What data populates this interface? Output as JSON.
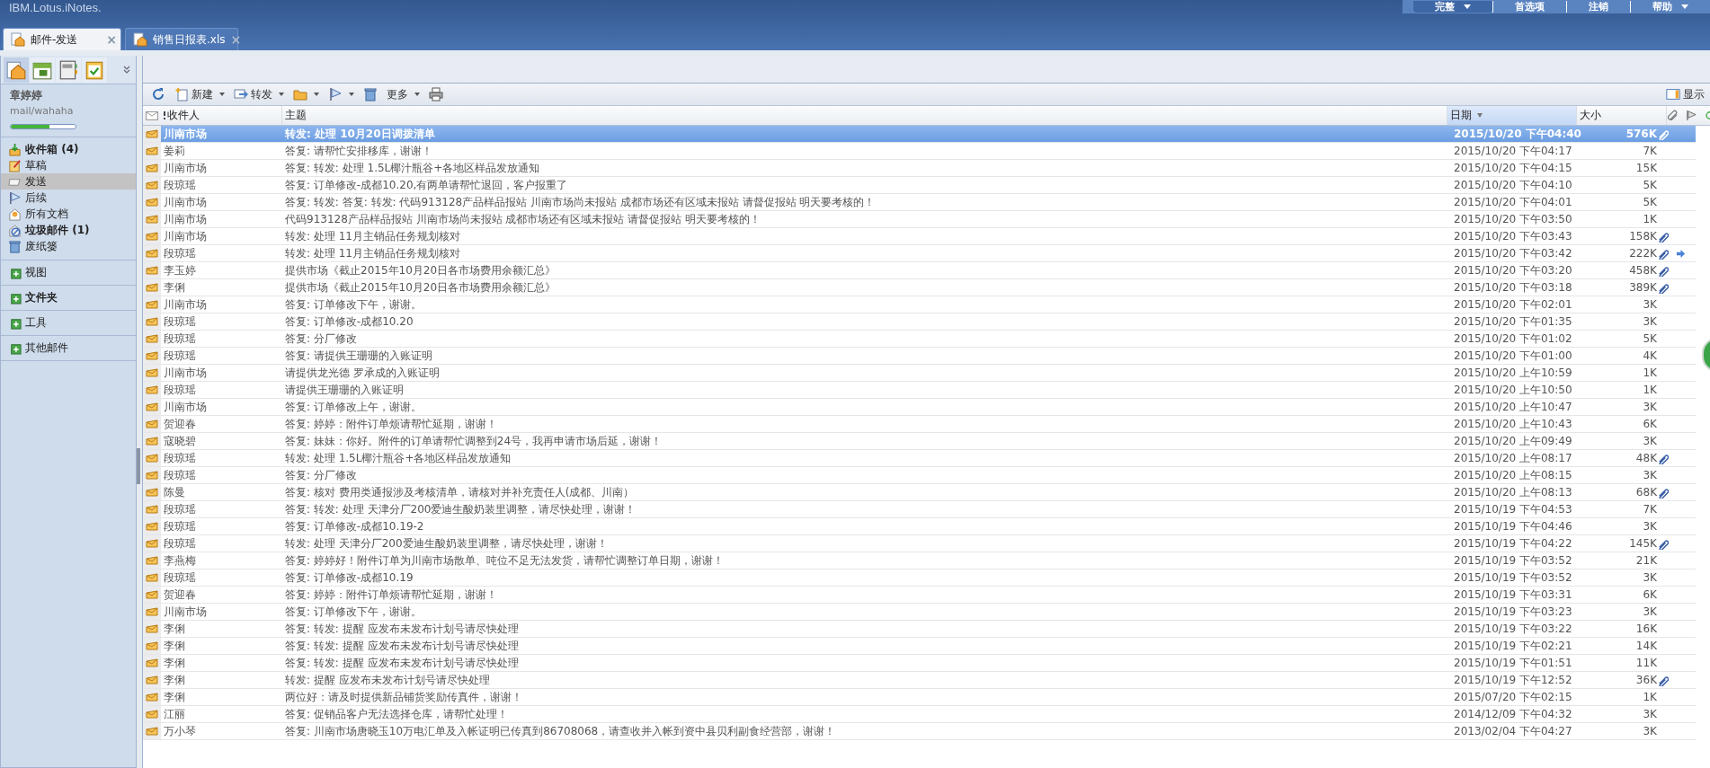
{
  "app": {
    "title": "IBM.Lotus.iNotes."
  },
  "top_menu": [
    {
      "label": "完整",
      "kind": "dropdown"
    },
    {
      "label": "首选项",
      "kind": "link"
    },
    {
      "label": "注销",
      "kind": "link"
    },
    {
      "label": "帮助",
      "kind": "dropdown"
    }
  ],
  "tabs": [
    {
      "label": "邮件-发送",
      "selected": true,
      "close": "×"
    },
    {
      "label": "销售日报表.xls",
      "selected": false,
      "close": "×"
    }
  ],
  "sidebar": {
    "user": "章婷婷",
    "mail_file": "mail/wahaha",
    "quota": {
      "level": 0.6
    },
    "folders": [
      {
        "label": "收件箱 (4)",
        "unread": true,
        "selected": false
      },
      {
        "label": "草稿",
        "unread": false,
        "selected": false
      },
      {
        "label": "发送",
        "unread": false,
        "selected": true
      },
      {
        "label": "后续",
        "unread": false,
        "selected": false
      },
      {
        "label": "所有文档",
        "unread": false,
        "selected": false
      },
      {
        "label": "垃圾邮件 (1)",
        "unread": true,
        "selected": false
      },
      {
        "label": "废纸篓",
        "unread": false,
        "selected": false
      }
    ],
    "sections": [
      {
        "label": "视图",
        "bold": false
      },
      {
        "label": "文件夹",
        "bold": true
      },
      {
        "label": "工具",
        "bold": false
      },
      {
        "label": "其他邮件",
        "bold": false
      }
    ]
  },
  "toolbar": [
    {
      "kind": "refresh",
      "menu": false
    },
    {
      "kind": "new",
      "label": "新建",
      "menu": true
    },
    {
      "kind": "forward",
      "label": "转发",
      "menu": true
    },
    {
      "kind": "folder",
      "menu": true
    },
    {
      "kind": "flag",
      "menu": true
    },
    {
      "kind": "delete",
      "menu": false
    },
    {
      "kind": "more",
      "label": "更多",
      "menu": true
    },
    {
      "kind": "print",
      "menu": false
    }
  ],
  "view_toggle": {
    "label": "显示"
  },
  "table": {
    "columns": [
      {
        "label": "收件人",
        "sorted": false
      },
      {
        "label": "主题",
        "sorted": false
      },
      {
        "label": "日期",
        "sorted": true
      },
      {
        "label": "大小",
        "sorted": false
      }
    ],
    "rows": [
      {
        "to": "川南市场",
        "subject": "转发: 处理 10月20日调拨清单",
        "date": "2015/10/20 下午04:40",
        "size": "576K",
        "attachment": true,
        "forwarded": false,
        "selected": true
      },
      {
        "to": "姜莉",
        "subject": "答复: 请帮忙安排移库，谢谢！",
        "date": "2015/10/20 下午04:17",
        "size": "7K",
        "attachment": false,
        "forwarded": false,
        "selected": false
      },
      {
        "to": "川南市场",
        "subject": "答复: 转发: 处理 1.5L椰汁瓶谷+各地区样品发放通知",
        "date": "2015/10/20 下午04:15",
        "size": "15K",
        "attachment": false,
        "forwarded": false,
        "selected": false
      },
      {
        "to": "段琼瑶",
        "subject": "答复: 订单修改-成都10.20,有两单请帮忙退回，客户报重了",
        "date": "2015/10/20 下午04:10",
        "size": "5K",
        "attachment": false,
        "forwarded": false,
        "selected": false
      },
      {
        "to": "川南市场",
        "subject": "答复: 转发: 答复: 转发: 代码913128产品样品报站 川南市场尚未报站 成都市场还有区域未报站 请督促报站 明天要考核的！",
        "date": "2015/10/20 下午04:01",
        "size": "5K",
        "attachment": false,
        "forwarded": false,
        "selected": false
      },
      {
        "to": "川南市场",
        "subject": "代码913128产品样品报站 川南市场尚未报站 成都市场还有区域未报站 请督促报站 明天要考核的！",
        "date": "2015/10/20 下午03:50",
        "size": "1K",
        "attachment": false,
        "forwarded": false,
        "selected": false
      },
      {
        "to": "川南市场",
        "subject": "转发: 处理 11月主销品任务规划核对",
        "date": "2015/10/20 下午03:43",
        "size": "158K",
        "attachment": true,
        "forwarded": false,
        "selected": false
      },
      {
        "to": "段琼瑶",
        "subject": "转发: 处理 11月主销品任务规划核对",
        "date": "2015/10/20 下午03:42",
        "size": "222K",
        "attachment": true,
        "forwarded": true,
        "selected": false
      },
      {
        "to": "李玉婷",
        "subject": "提供市场《截止2015年10月20日各市场费用余额汇总》",
        "date": "2015/10/20 下午03:20",
        "size": "458K",
        "attachment": true,
        "forwarded": false,
        "selected": false
      },
      {
        "to": "李俐",
        "subject": "提供市场《截止2015年10月20日各市场费用余额汇总》",
        "date": "2015/10/20 下午03:18",
        "size": "389K",
        "attachment": true,
        "forwarded": false,
        "selected": false
      },
      {
        "to": "川南市场",
        "subject": "答复: 订单修改下午，谢谢。",
        "date": "2015/10/20 下午02:01",
        "size": "3K",
        "attachment": false,
        "forwarded": false,
        "selected": false
      },
      {
        "to": "段琼瑶",
        "subject": "答复: 订单修改-成都10.20",
        "date": "2015/10/20 下午01:35",
        "size": "3K",
        "attachment": false,
        "forwarded": false,
        "selected": false
      },
      {
        "to": "段琼瑶",
        "subject": "答复: 分厂修改",
        "date": "2015/10/20 下午01:02",
        "size": "5K",
        "attachment": false,
        "forwarded": false,
        "selected": false
      },
      {
        "to": "段琼瑶",
        "subject": "答复: 请提供王珊珊的入账证明",
        "date": "2015/10/20 下午01:00",
        "size": "4K",
        "attachment": false,
        "forwarded": false,
        "selected": false
      },
      {
        "to": "川南市场",
        "subject": "请提供龙光德 罗承成的入账证明",
        "date": "2015/10/20 上午10:59",
        "size": "1K",
        "attachment": false,
        "forwarded": false,
        "selected": false
      },
      {
        "to": "段琼瑶",
        "subject": "请提供王珊珊的入账证明",
        "date": "2015/10/20 上午10:50",
        "size": "1K",
        "attachment": false,
        "forwarded": false,
        "selected": false
      },
      {
        "to": "川南市场",
        "subject": "答复: 订单修改上午，谢谢。",
        "date": "2015/10/20 上午10:47",
        "size": "3K",
        "attachment": false,
        "forwarded": false,
        "selected": false
      },
      {
        "to": "贺迎春",
        "subject": "答复: 婷婷：附件订单烦请帮忙延期，谢谢！",
        "date": "2015/10/20 上午10:43",
        "size": "6K",
        "attachment": false,
        "forwarded": false,
        "selected": false
      },
      {
        "to": "寇晓碧",
        "subject": "答复: 妹妹：你好。附件的订单请帮忙调整到24号，我再申请市场后延，谢谢！",
        "date": "2015/10/20 上午09:49",
        "size": "3K",
        "attachment": false,
        "forwarded": false,
        "selected": false
      },
      {
        "to": "段琼瑶",
        "subject": "转发: 处理 1.5L椰汁瓶谷+各地区样品发放通知",
        "date": "2015/10/20 上午08:17",
        "size": "48K",
        "attachment": true,
        "forwarded": false,
        "selected": false
      },
      {
        "to": "段琼瑶",
        "subject": "答复: 分厂修改",
        "date": "2015/10/20 上午08:15",
        "size": "3K",
        "attachment": false,
        "forwarded": false,
        "selected": false
      },
      {
        "to": "陈曼",
        "subject": "答复: 核对 费用类通报涉及考核清单，请核对并补充责任人(成都、川南）",
        "date": "2015/10/20 上午08:13",
        "size": "68K",
        "attachment": true,
        "forwarded": false,
        "selected": false
      },
      {
        "to": "段琼瑶",
        "subject": "答复: 转发: 处理 天津分厂200爱迪生酸奶装里调整，请尽快处理，谢谢！",
        "date": "2015/10/19 下午04:53",
        "size": "7K",
        "attachment": false,
        "forwarded": false,
        "selected": false
      },
      {
        "to": "段琼瑶",
        "subject": "答复: 订单修改-成都10.19-2",
        "date": "2015/10/19 下午04:46",
        "size": "3K",
        "attachment": false,
        "forwarded": false,
        "selected": false
      },
      {
        "to": "段琼瑶",
        "subject": "转发: 处理 天津分厂200爱迪生酸奶装里调整，请尽快处理，谢谢！",
        "date": "2015/10/19 下午04:22",
        "size": "145K",
        "attachment": true,
        "forwarded": false,
        "selected": false
      },
      {
        "to": "李燕梅",
        "subject": "答复: 婷婷好！附件订单为川南市场散单、吨位不足无法发货，请帮忙调整订单日期，谢谢！",
        "date": "2015/10/19 下午03:52",
        "size": "21K",
        "attachment": false,
        "forwarded": false,
        "selected": false
      },
      {
        "to": "段琼瑶",
        "subject": "答复: 订单修改-成都10.19",
        "date": "2015/10/19 下午03:52",
        "size": "3K",
        "attachment": false,
        "forwarded": false,
        "selected": false
      },
      {
        "to": "贺迎春",
        "subject": "答复: 婷婷：附件订单烦请帮忙延期，谢谢！",
        "date": "2015/10/19 下午03:31",
        "size": "6K",
        "attachment": false,
        "forwarded": false,
        "selected": false
      },
      {
        "to": "川南市场",
        "subject": "答复: 订单修改下午，谢谢。",
        "date": "2015/10/19 下午03:23",
        "size": "3K",
        "attachment": false,
        "forwarded": false,
        "selected": false
      },
      {
        "to": "李俐",
        "subject": "答复: 转发: 提醒 应发布未发布计划号请尽快处理",
        "date": "2015/10/19 下午03:22",
        "size": "16K",
        "attachment": false,
        "forwarded": false,
        "selected": false
      },
      {
        "to": "李俐",
        "subject": "答复: 转发: 提醒 应发布未发布计划号请尽快处理",
        "date": "2015/10/19 下午02:21",
        "size": "14K",
        "attachment": false,
        "forwarded": false,
        "selected": false
      },
      {
        "to": "李俐",
        "subject": "答复: 转发: 提醒 应发布未发布计划号请尽快处理",
        "date": "2015/10/19 下午01:51",
        "size": "11K",
        "attachment": false,
        "forwarded": false,
        "selected": false
      },
      {
        "to": "李俐",
        "subject": "转发: 提醒 应发布未发布计划号请尽快处理",
        "date": "2015/10/19 下午12:52",
        "size": "36K",
        "attachment": true,
        "forwarded": false,
        "selected": false
      },
      {
        "to": "李俐",
        "subject": "两位好：请及时提供新品铺货奖励传真件，谢谢！",
        "date": "2015/07/20 下午02:15",
        "size": "1K",
        "attachment": false,
        "forwarded": false,
        "selected": false
      },
      {
        "to": "江丽",
        "subject": "答复: 促销品客户无法选择仓库，请帮忙处理！",
        "date": "2014/12/09 下午04:32",
        "size": "3K",
        "attachment": false,
        "forwarded": false,
        "selected": false
      },
      {
        "to": "万小琴",
        "subject": "答复: 川南市场唐晓玉10万电汇单及入帐证明已传真到86708068，请查收并入帐到资中县贝利副食经营部，谢谢！",
        "date": "2013/02/04 下午04:27",
        "size": "3K",
        "attachment": false,
        "forwarded": false,
        "selected": false
      }
    ]
  }
}
